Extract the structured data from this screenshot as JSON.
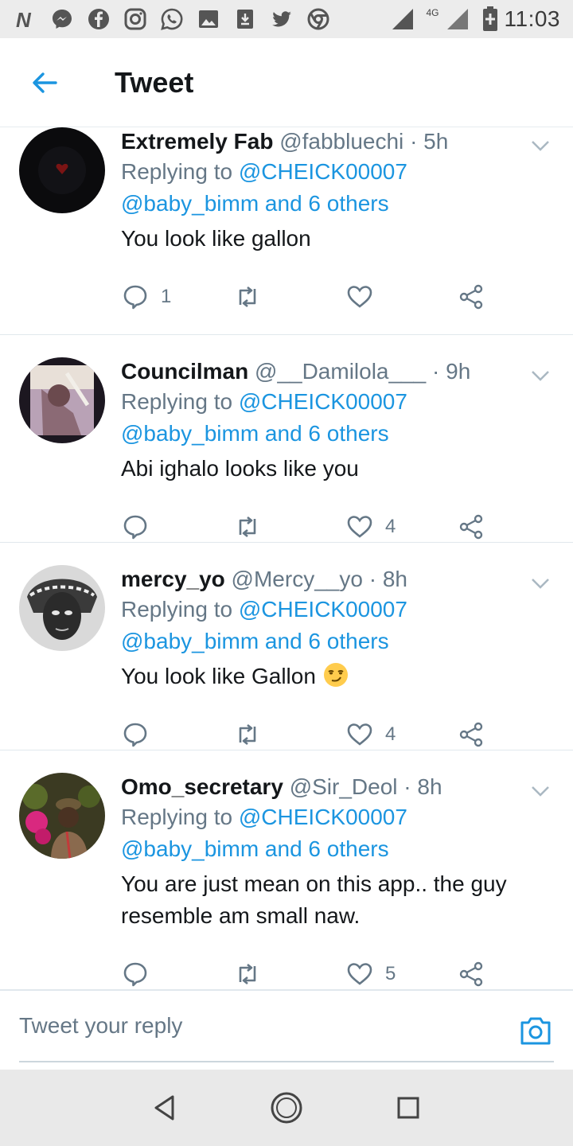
{
  "status_bar": {
    "time": "11:03",
    "network": "4G",
    "icons": [
      "n-notification-icon",
      "messenger-icon",
      "facebook-icon",
      "instagram-icon",
      "whatsapp-icon",
      "gallery-icon",
      "download-icon",
      "twitter-icon",
      "chrome-icon"
    ]
  },
  "header": {
    "title": "Tweet",
    "back_icon": "arrow-left-icon"
  },
  "tweets": [
    {
      "name": "Extremely Fab",
      "handle": "@fabbluechi",
      "time": "5h",
      "replying_label": "Replying to",
      "replying_to": "@CHEICK00007",
      "others": "@baby_bimm and 6 others",
      "text": "You look like gallon",
      "reply_count": "1",
      "retweet_count": "",
      "like_count": ""
    },
    {
      "name": "Councilman",
      "handle": "@__Damilola___",
      "time": "9h",
      "replying_label": "Replying to",
      "replying_to": "@CHEICK00007",
      "others": "@baby_bimm and 6 others",
      "text": "Abi ighalo looks like you",
      "reply_count": "",
      "retweet_count": "",
      "like_count": "4"
    },
    {
      "name": "mercy_yo",
      "handle": "@Mercy__yo",
      "time": "8h",
      "replying_label": "Replying to",
      "replying_to": "@CHEICK00007",
      "others": "@baby_bimm and 6 others",
      "text": "You look like Gallon",
      "reply_count": "",
      "retweet_count": "",
      "like_count": "4"
    },
    {
      "name": "Omo_secretary",
      "handle": "@Sir_Deol",
      "time": "8h",
      "replying_label": "Replying to",
      "replying_to": "@CHEICK00007",
      "others": "@baby_bimm and 6 others",
      "text": "You are just mean on this app.. the guy resemble am small naw.",
      "reply_count": "",
      "retweet_count": "",
      "like_count": "5"
    }
  ],
  "reply_bar": {
    "placeholder": "Tweet your reply",
    "camera_icon": "camera-icon"
  },
  "nav_bar": {
    "icons": [
      "back-triangle-icon",
      "home-circle-icon",
      "recents-square-icon"
    ]
  },
  "colors": {
    "accent": "#1b95e0",
    "text": "#14171a",
    "secondary": "#657786",
    "divider": "#e1e8ed"
  }
}
